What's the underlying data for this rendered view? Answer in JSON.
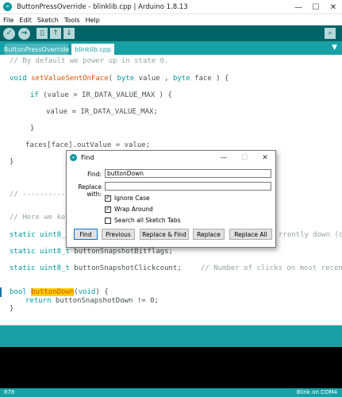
{
  "window": {
    "app_icon_glyph": "∞",
    "title": "ButtonPressOverride - blinklib.cpp | Arduino 1.8.13",
    "controls": {
      "minimize": "—",
      "maximize": "☐",
      "close": "✕"
    }
  },
  "menu": [
    "File",
    "Edit",
    "Sketch",
    "Tools",
    "Help"
  ],
  "toolbar": {
    "verify_glyph": "✓",
    "upload_glyph": "→",
    "new_glyph": "▯",
    "open_glyph": "↑",
    "save_glyph": "↓",
    "monitor_glyph": "⌕"
  },
  "tabs": [
    {
      "label": "ButtonPressOverride"
    },
    {
      "label": "blinklib.cpp"
    }
  ],
  "tab_menu_glyph": "▼",
  "code": {
    "l1": "// By default we power up in state 0.",
    "l2_kw": "void",
    "l2_fn": "setValueSentOnFace",
    "l2_a": "( ",
    "l2_kw2": "byte",
    "l2_b": " value , ",
    "l2_kw3": "byte",
    "l2_c": " face ) {",
    "l3_kw": "if",
    "l3_rest": " (value > IR_DATA_VALUE_MAX ) {",
    "l4": "value = IR_DATA_VALUE_MAX;",
    "l5": "}",
    "l6": "faces[face].outValue = value;",
    "l7": "}",
    "l8": "// ------------",
    "l9": "// Here we kee",
    "l10_kw": "static",
    "l10_kw2": "uint8_t",
    "l10_tail": "rrently down (c",
    "l11_kw": "static",
    "l11_kw2": "uint8_t",
    "l11_rest": " buttonSnapshotBitflags;",
    "l12_kw": "static",
    "l12_kw2": "uint8_t",
    "l12_rest": " buttonSnapshotClickcount;",
    "l12_comment": "// Number of clicks on most recent",
    "l13_kw": "bool",
    "l13_fn": "buttonDown",
    "l13_a": "(",
    "l13_kw2": "void",
    "l13_b": ") {",
    "l14_kw": "return",
    "l14_rest": " buttonSnapshotDown != 0;",
    "l15": "}"
  },
  "find_dialog": {
    "title": "Find",
    "title_icon_glyph": "∞",
    "controls": {
      "minimize": "—",
      "maximize": "☐",
      "close": "✕"
    },
    "find_label": "Find:",
    "find_value": "buttonDown",
    "replace_label": "Replace with:",
    "replace_value": "",
    "check_mark": "✓",
    "options": [
      {
        "label": "Ignore Case",
        "checked": true
      },
      {
        "label": "Wrap Around",
        "checked": true
      },
      {
        "label": "Search all Sketch Tabs",
        "checked": false
      }
    ],
    "buttons": [
      "Find",
      "Previous",
      "Replace & Find",
      "Replace",
      "Replace All"
    ]
  },
  "footer": {
    "line_number": "878",
    "board": "Blink on COM4"
  },
  "colors": {
    "toolbar": "#006468",
    "teal": "#17a1a5",
    "keyword": "#00979c",
    "function": "#d35400",
    "comment": "#95a5a6",
    "highlight": "#ffce00"
  }
}
